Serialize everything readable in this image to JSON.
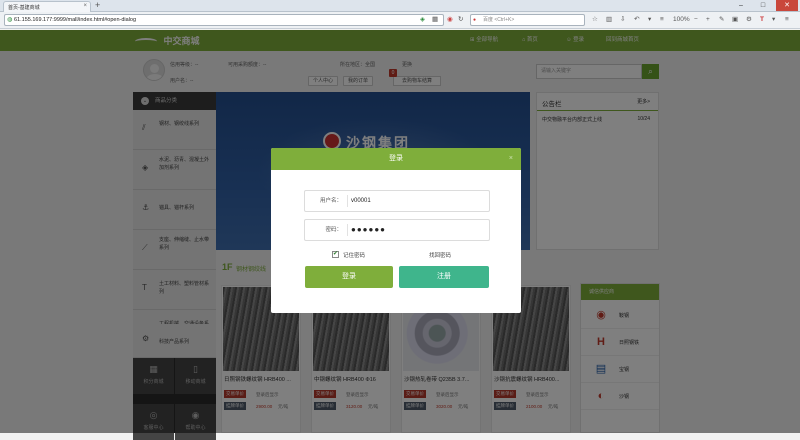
{
  "browser": {
    "tab_title": "首页-基建商城",
    "new_tab": "+",
    "url": "61.155.169.177:9999/mall/index.html#open-dialog",
    "search_placeholder": "百度 <Ctrl+K>",
    "zoom": "100%",
    "win_min": "–",
    "win_max": "□",
    "win_close": "✕"
  },
  "topnav": {
    "logo_text": "中交商城",
    "items": [
      "全部导航",
      "首页",
      "登录",
      "回到商城首页"
    ]
  },
  "header": {
    "level_label": "信用等级：--",
    "credit_label": "可用采购额度：--",
    "region_label": "所在地区：全国",
    "switch_label": "更换",
    "username_label": "用户名：--",
    "center_btn": "个人中心",
    "orders_btn": "我的订单",
    "cart_btn": "去购物车结算",
    "cart_count": "0",
    "search_placeholder": "请输入关键字",
    "search_icon": "search-icon"
  },
  "sidebar": {
    "title": "商品分类",
    "items": [
      {
        "label": "钢材、钢绞线系列",
        "icon": "bars-icon"
      },
      {
        "label": "水泥、沥青、混凝土外加剂系列",
        "icon": "cube-icon"
      },
      {
        "label": "锚具、锚杆系列",
        "icon": "anchor-icon"
      },
      {
        "label": "支座、伸缩缝、止水带系列",
        "icon": "support-icon"
      },
      {
        "label": "土工材料、塑料管材系列",
        "icon": "t-icon"
      },
      {
        "label": "工程机械、交通设备系列",
        "icon": "machine-icon"
      },
      {
        "label": "科技产品系列",
        "icon": "gear-icon"
      }
    ],
    "footer": [
      {
        "label": "积分商城",
        "icon": "grid-icon"
      },
      {
        "label": "移动商城",
        "icon": "phone-icon"
      },
      {
        "label": "客服中心",
        "icon": "headset-icon"
      },
      {
        "label": "帮助中心",
        "icon": "help-icon"
      }
    ]
  },
  "banner": {
    "text": "沙钢集团"
  },
  "notice": {
    "title": "公告栏",
    "more": "更多>",
    "item": "中交物融平台内部正式上线",
    "date": "10/24"
  },
  "floor": {
    "number": "1F",
    "title": "钢材钢绞线"
  },
  "products": [
    {
      "name": "日照钢铁螺纹钢 HRB400 ...",
      "tag1": "交易单价",
      "tag2": "挂牌单价",
      "login_text": "登录后显示",
      "price": "2900.00",
      "unit": "元/吨",
      "img": "rebar"
    },
    {
      "name": "中钢螺纹钢 HRB400 Φ16",
      "tag1": "交易单价",
      "tag2": "挂牌单价",
      "login_text": "登录后显示",
      "price": "3120.00",
      "unit": "元/吨",
      "img": "rebar"
    },
    {
      "name": "沙钢热轧卷带 Q235B 3.7...",
      "tag1": "交易单价",
      "tag2": "挂牌单价",
      "login_text": "登录后显示",
      "price": "3020.00",
      "unit": "元/吨",
      "img": "coil"
    },
    {
      "name": "沙钢抗震螺纹钢 HRB400...",
      "tag1": "交易单价",
      "tag2": "挂牌单价",
      "login_text": "登录后显示",
      "price": "2100.00",
      "unit": "元/吨",
      "img": "rebar"
    }
  ],
  "brands": {
    "title": "诚信供应商",
    "items": [
      {
        "name": "鞍钢",
        "color": "#c0392b",
        "glyph": "◉"
      },
      {
        "name": "日照钢铁",
        "color": "#c0392b",
        "glyph": "H"
      },
      {
        "name": "宝钢",
        "color": "#1f5aa6",
        "glyph": "▤"
      },
      {
        "name": "沙钢",
        "color": "#c0392b",
        "glyph": "◐"
      }
    ]
  },
  "dialog": {
    "title": "登录",
    "close": "×",
    "username_label": "用户名：",
    "username_value": "v00001",
    "password_label": "密码：",
    "password_value": "●●●●●●",
    "remember_label": "记住密码",
    "remember_checked": "✔",
    "forgot_label": "找回密码",
    "login_btn": "登录",
    "register_btn": "注册"
  },
  "colors": {
    "accent": "#7fae3b",
    "register": "#3fb58c",
    "price": "#c0392b"
  }
}
